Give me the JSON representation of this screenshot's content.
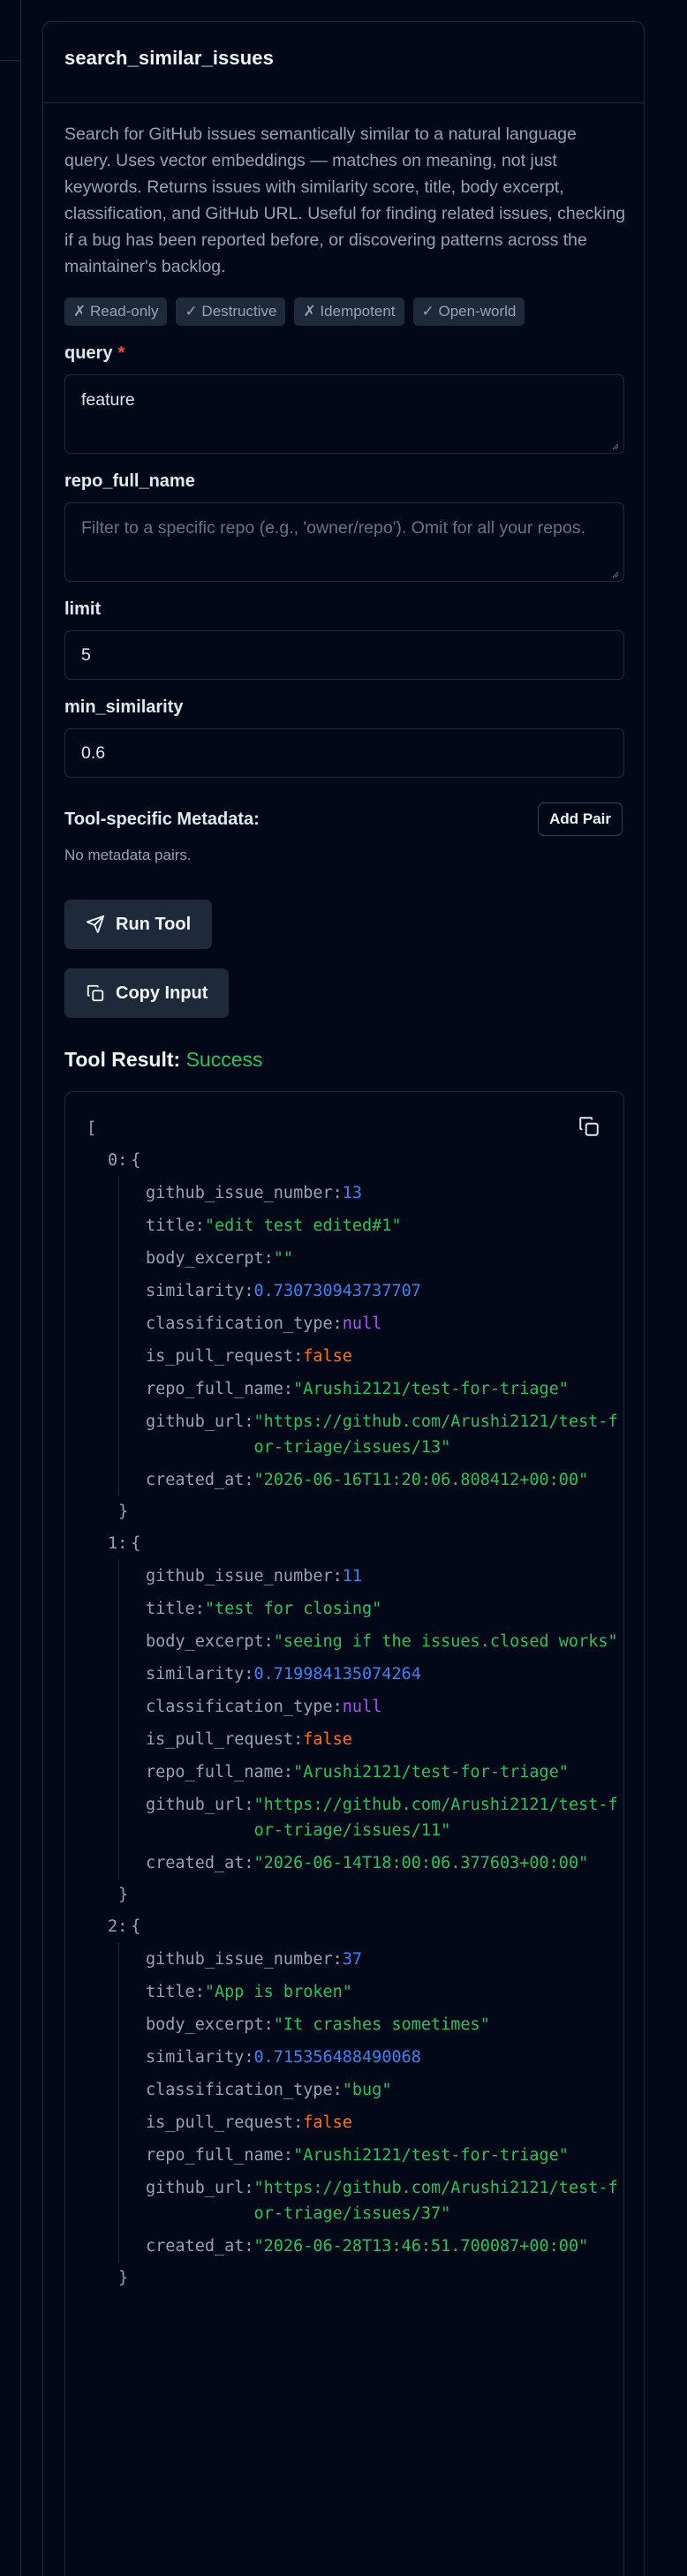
{
  "tool": {
    "name": "search_similar_issues",
    "description": "Search for GitHub issues semantically similar to a natural language query. Uses vector embeddings — matches on meaning, not just keywords. Returns issues with similarity score, title, body excerpt, classification, and GitHub URL. Useful for finding related issues, checking if a bug has been reported before, or discovering patterns across the maintainer's backlog.",
    "badges": [
      "✗ Read-only",
      "✓ Destructive",
      "✗ Idempotent",
      "✓ Open-world"
    ]
  },
  "form": {
    "query": {
      "label": "query",
      "required_mark": "*",
      "value": "feature"
    },
    "repo_full_name": {
      "label": "repo_full_name",
      "placeholder": "Filter to a specific repo (e.g., 'owner/repo'). Omit for all your repos."
    },
    "limit": {
      "label": "limit",
      "value": "5"
    },
    "min_similarity": {
      "label": "min_similarity",
      "value": "0.6"
    }
  },
  "metadata": {
    "label": "Tool-specific Metadata:",
    "add_pair_label": "Add Pair",
    "empty_text": "No metadata pairs."
  },
  "actions": {
    "run_label": "Run Tool",
    "copy_label": "Copy Input"
  },
  "result": {
    "title": "Tool Result:",
    "status": "Success",
    "open_bracket": "[",
    "items": [
      {
        "index": "0:",
        "fields": [
          {
            "key": "github_issue_number:",
            "value": "13",
            "type": "number"
          },
          {
            "key": "title:",
            "value": "\"edit test edited#1\"",
            "type": "string"
          },
          {
            "key": "body_excerpt:",
            "value": "\"\"",
            "type": "string"
          },
          {
            "key": "similarity:",
            "value": "0.730730943737707",
            "type": "number"
          },
          {
            "key": "classification_type:",
            "value": "null",
            "type": "null"
          },
          {
            "key": "is_pull_request:",
            "value": "false",
            "type": "bool"
          },
          {
            "key": "repo_full_name:",
            "value": "\"Arushi2121/test-for-triage\"",
            "type": "string"
          },
          {
            "key": "github_url:",
            "value": "\"https://github.com/Arushi2121/test-for-triage/issues/13\"",
            "type": "string"
          },
          {
            "key": "created_at:",
            "value": "\"2026-06-16T11:20:06.808412+00:00\"",
            "type": "string"
          }
        ]
      },
      {
        "index": "1:",
        "fields": [
          {
            "key": "github_issue_number:",
            "value": "11",
            "type": "number"
          },
          {
            "key": "title:",
            "value": "\"test for closing\"",
            "type": "string"
          },
          {
            "key": "body_excerpt:",
            "value": "\"seeing if the issues.closed works\"",
            "type": "string"
          },
          {
            "key": "similarity:",
            "value": "0.719984135074264",
            "type": "number"
          },
          {
            "key": "classification_type:",
            "value": "null",
            "type": "null"
          },
          {
            "key": "is_pull_request:",
            "value": "false",
            "type": "bool"
          },
          {
            "key": "repo_full_name:",
            "value": "\"Arushi2121/test-for-triage\"",
            "type": "string"
          },
          {
            "key": "github_url:",
            "value": "\"https://github.com/Arushi2121/test-for-triage/issues/11\"",
            "type": "string"
          },
          {
            "key": "created_at:",
            "value": "\"2026-06-14T18:00:06.377603+00:00\"",
            "type": "string"
          }
        ]
      },
      {
        "index": "2:",
        "fields": [
          {
            "key": "github_issue_number:",
            "value": "37",
            "type": "number"
          },
          {
            "key": "title:",
            "value": "\"App is broken\"",
            "type": "string"
          },
          {
            "key": "body_excerpt:",
            "value": "\"It crashes sometimes\"",
            "type": "string"
          },
          {
            "key": "similarity:",
            "value": "0.715356488490068",
            "type": "number"
          },
          {
            "key": "classification_type:",
            "value": "\"bug\"",
            "type": "string"
          },
          {
            "key": "is_pull_request:",
            "value": "false",
            "type": "bool"
          },
          {
            "key": "repo_full_name:",
            "value": "\"Arushi2121/test-for-triage\"",
            "type": "string"
          },
          {
            "key": "github_url:",
            "value": "\"https://github.com/Arushi2121/test-for-triage/issues/37\"",
            "type": "string"
          },
          {
            "key": "created_at:",
            "value": "\"2026-06-28T13:46:51.700087+00:00\"",
            "type": "string"
          }
        ]
      }
    ],
    "open_brace": "{",
    "close_brace": "}"
  }
}
